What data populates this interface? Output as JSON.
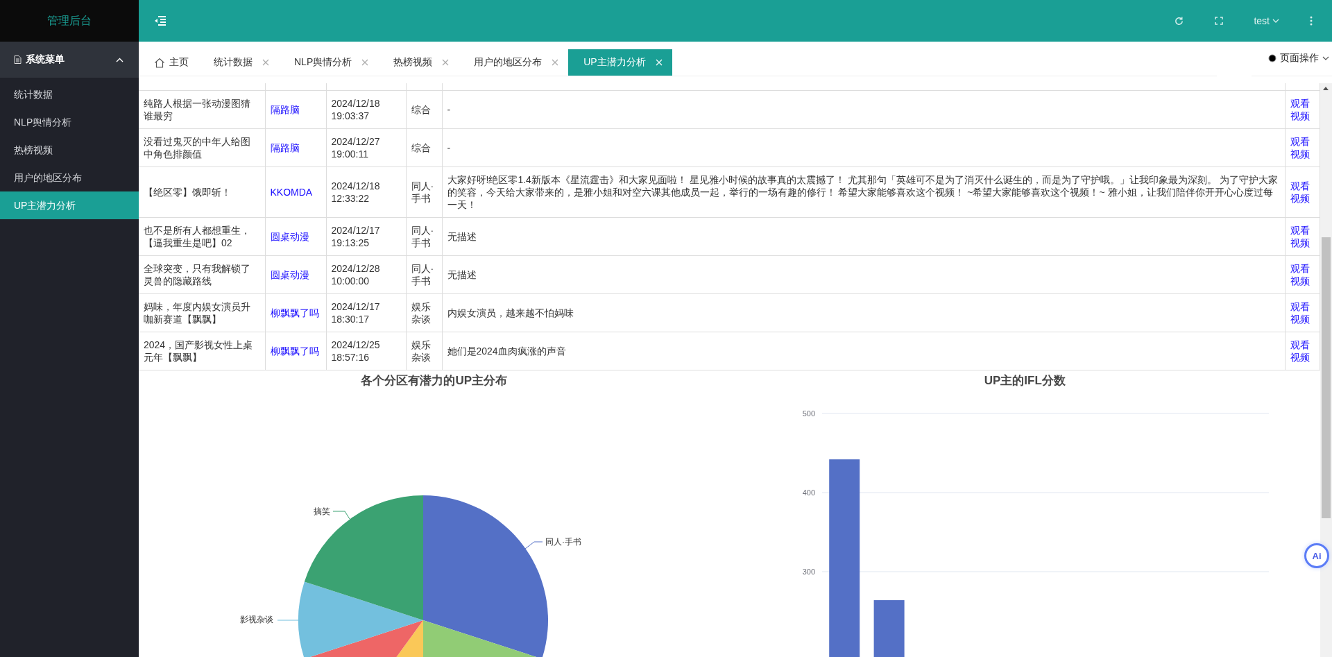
{
  "sidebar": {
    "logo": "管理后台",
    "menu": {
      "label": "系统菜单",
      "expanded": true,
      "items": [
        {
          "label": "统计数据",
          "selected": false
        },
        {
          "label": "NLP舆情分析",
          "selected": false
        },
        {
          "label": "热榜视频",
          "selected": false
        },
        {
          "label": "用户的地区分布",
          "selected": false
        },
        {
          "label": "UP主潜力分析",
          "selected": true
        }
      ]
    }
  },
  "header": {
    "user": "test"
  },
  "tabs": [
    {
      "label": "主页",
      "kind": "home",
      "selected": false
    },
    {
      "label": "统计数据",
      "kind": "closable",
      "selected": false
    },
    {
      "label": "NLP舆情分析",
      "kind": "closable",
      "selected": false
    },
    {
      "label": "热榜视频",
      "kind": "closable",
      "selected": false
    },
    {
      "label": "用户的地区分布",
      "kind": "closable",
      "selected": false
    },
    {
      "label": "UP主潜力分析",
      "kind": "closable",
      "selected": true
    }
  ],
  "page_actions": {
    "label": "页面操作"
  },
  "table": {
    "rows": [
      {
        "title": "纯路人根据一张动漫图猜谁最穷",
        "author": "隔路脑",
        "time": "2024/12/18 19:03:37",
        "category": "综合",
        "description": "-",
        "link": "观看视频"
      },
      {
        "title": "没看过鬼灭的中年人给图中角色排颜值",
        "author": "隔路脑",
        "time": "2024/12/27 19:00:11",
        "category": "综合",
        "description": "-",
        "link": "观看视频"
      },
      {
        "title": "【绝区零】饿即斩！",
        "author": "KKOMDA",
        "time": "2024/12/18 12:33:22",
        "category": "同人·手书",
        "description": "大家好呀!绝区零1.4新版本《星流霆击》和大家见面啦！ 星见雅小时候的故事真的太震撼了！ 尤其那句「英雄可不是为了消灭什么诞生的，而是为了守护哦。」让我印象最为深刻。 为了守护大家的笑容，今天给大家带来的，是雅小姐和对空六课其他成员一起，举行的一场有趣的修行！ 希望大家能够喜欢这个视频！ ~希望大家能够喜欢这个视频！~ 雅小姐，让我们陪伴你开开心心度过每一天！",
        "link": "观看视频"
      },
      {
        "title": "也不是所有人都想重生，【逼我重生是吧】02",
        "author": "圆桌动漫",
        "time": "2024/12/17 19:13:25",
        "category": "同人·手书",
        "description": "无描述",
        "link": "观看视频"
      },
      {
        "title": "全球突变，只有我解锁了灵兽的隐藏路线",
        "author": "圆桌动漫",
        "time": "2024/12/28 10:00:00",
        "category": "同人·手书",
        "description": "无描述",
        "link": "观看视频"
      },
      {
        "title": "妈味，年度内娱女演员升咖新赛道【飘飘】",
        "author": "柳飘飘了吗",
        "time": "2024/12/17 18:30:17",
        "category": "娱乐杂谈",
        "description": "内娱女演员，越来越不怕妈味",
        "link": "观看视频"
      },
      {
        "title": "2024，国产影视女性上桌元年【飘飘】",
        "author": "柳飘飘了吗",
        "time": "2024/12/25 18:57:16",
        "category": "娱乐杂谈",
        "description": "她们是2024血肉疯涨的声音",
        "link": "观看视频"
      }
    ]
  },
  "pie": {
    "title": "各个分区有潜力的UP主分布",
    "labels": [
      "同人·手书",
      "影视杂谈",
      "搞笑"
    ]
  },
  "bar": {
    "chart_data": {
      "type": "bar",
      "title": "UP主的IFL分数",
      "values": [
        442,
        264,
        null,
        null,
        null,
        null,
        null,
        null,
        null,
        null
      ],
      "ylim": [
        186,
        500
      ],
      "yticks": [
        300,
        400,
        500
      ]
    }
  },
  "ai_button": {
    "label": "Ai"
  }
}
